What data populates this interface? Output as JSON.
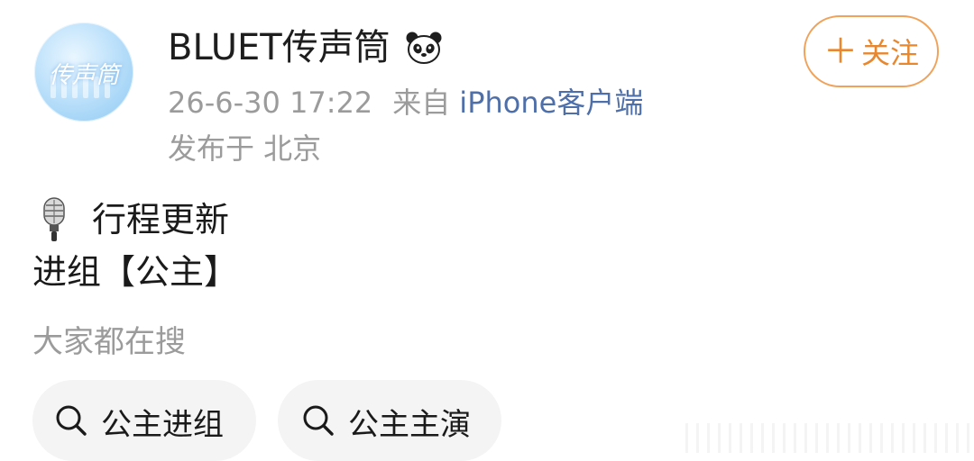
{
  "post": {
    "author": "BLUET传声筒",
    "author_badge_icon": "panda-icon",
    "avatar_text": "传声筒",
    "date": "26-6-30 17:22",
    "source_prefix": "来自",
    "source": "iPhone客户端",
    "location": "发布于 北京",
    "follow_label": "关注",
    "follow_plus": "＋",
    "line1": "行程更新",
    "line1_icon": "microphone-icon",
    "line2": "进组【公主】"
  },
  "hot_search": {
    "label": "大家都在搜",
    "chips": [
      {
        "text": "公主进组",
        "icon": "search-icon"
      },
      {
        "text": "公主主演",
        "icon": "search-icon"
      }
    ]
  },
  "colors": {
    "follow_accent": "#e9872e",
    "source_link": "#4f6fa8",
    "meta_gray": "#9b9b9b"
  }
}
